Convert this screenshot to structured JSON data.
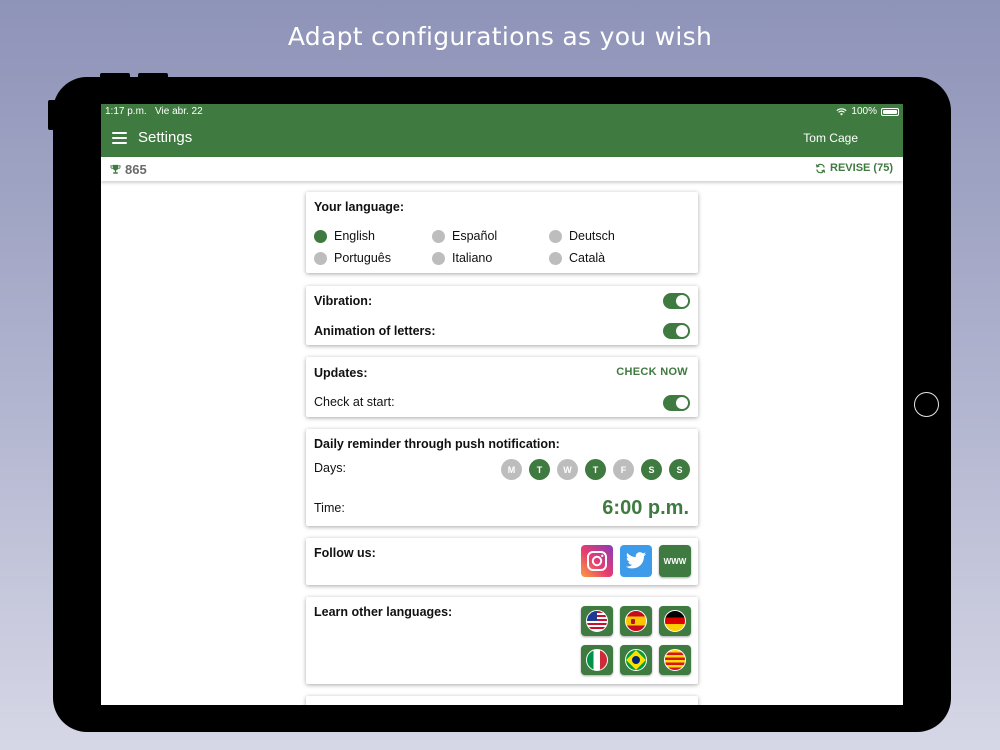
{
  "headline": "Adapt configurations  as you wish",
  "status_bar": {
    "time": "1:17 p.m.",
    "date": "Vie abr. 22",
    "battery": "100%"
  },
  "nav": {
    "title": "Settings",
    "user": "Tom Cage"
  },
  "score_bar": {
    "score": "865",
    "revise_label": "REVISE (75)"
  },
  "language": {
    "title": "Your language:",
    "options": [
      {
        "label": "English",
        "selected": true
      },
      {
        "label": "Español",
        "selected": false
      },
      {
        "label": "Deutsch",
        "selected": false
      },
      {
        "label": "Português",
        "selected": false
      },
      {
        "label": "Italiano",
        "selected": false
      },
      {
        "label": "Català",
        "selected": false
      }
    ]
  },
  "vibration": {
    "label": "Vibration:",
    "enabled": true
  },
  "animation": {
    "label": "Animation of letters:",
    "enabled": true
  },
  "updates": {
    "title": "Updates:",
    "check_now": "CHECK NOW",
    "check_at_start": "Check at start:",
    "check_at_start_enabled": true
  },
  "reminder": {
    "title": "Daily reminder through push notification:",
    "days_label": "Days:",
    "days": [
      {
        "letter": "M",
        "on": false
      },
      {
        "letter": "T",
        "on": true
      },
      {
        "letter": "W",
        "on": false
      },
      {
        "letter": "T",
        "on": true
      },
      {
        "letter": "F",
        "on": false
      },
      {
        "letter": "S",
        "on": true
      },
      {
        "letter": "S",
        "on": true
      }
    ],
    "time_label": "Time:",
    "time_value": "6:00 p.m."
  },
  "follow": {
    "title": "Follow us:",
    "www_label": "WWW"
  },
  "learn": {
    "title": "Learn other languages:"
  },
  "colors": {
    "brand_green": "#3f7a40",
    "inactive_gray": "#bdbdbd"
  },
  "icons": [
    "menu-icon",
    "trophy-icon",
    "refresh-icon",
    "wifi-icon",
    "battery-icon",
    "instagram-icon",
    "twitter-icon",
    "flag-usa-icon",
    "flag-spain-icon",
    "flag-germany-icon",
    "flag-italy-icon",
    "flag-brazil-icon",
    "flag-catalonia-icon"
  ]
}
